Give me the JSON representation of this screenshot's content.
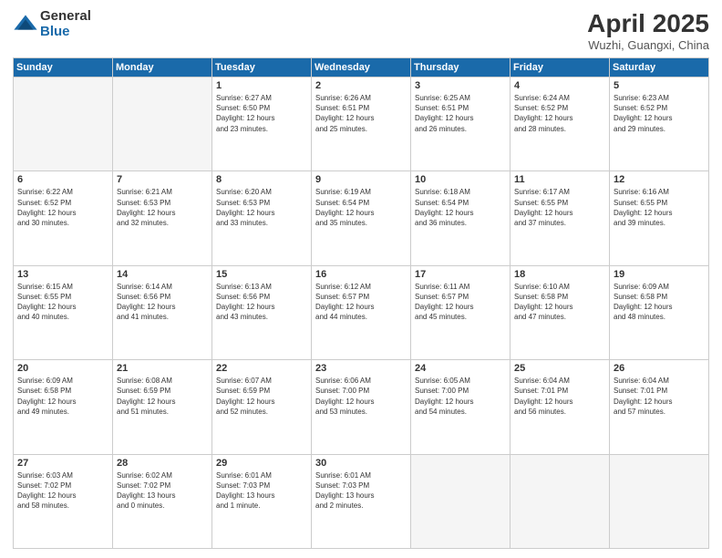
{
  "logo": {
    "general": "General",
    "blue": "Blue"
  },
  "header": {
    "month_year": "April 2025",
    "location": "Wuzhi, Guangxi, China"
  },
  "days_of_week": [
    "Sunday",
    "Monday",
    "Tuesday",
    "Wednesday",
    "Thursday",
    "Friday",
    "Saturday"
  ],
  "weeks": [
    [
      {
        "num": "",
        "info": ""
      },
      {
        "num": "",
        "info": ""
      },
      {
        "num": "1",
        "info": "Sunrise: 6:27 AM\nSunset: 6:50 PM\nDaylight: 12 hours\nand 23 minutes."
      },
      {
        "num": "2",
        "info": "Sunrise: 6:26 AM\nSunset: 6:51 PM\nDaylight: 12 hours\nand 25 minutes."
      },
      {
        "num": "3",
        "info": "Sunrise: 6:25 AM\nSunset: 6:51 PM\nDaylight: 12 hours\nand 26 minutes."
      },
      {
        "num": "4",
        "info": "Sunrise: 6:24 AM\nSunset: 6:52 PM\nDaylight: 12 hours\nand 28 minutes."
      },
      {
        "num": "5",
        "info": "Sunrise: 6:23 AM\nSunset: 6:52 PM\nDaylight: 12 hours\nand 29 minutes."
      }
    ],
    [
      {
        "num": "6",
        "info": "Sunrise: 6:22 AM\nSunset: 6:52 PM\nDaylight: 12 hours\nand 30 minutes."
      },
      {
        "num": "7",
        "info": "Sunrise: 6:21 AM\nSunset: 6:53 PM\nDaylight: 12 hours\nand 32 minutes."
      },
      {
        "num": "8",
        "info": "Sunrise: 6:20 AM\nSunset: 6:53 PM\nDaylight: 12 hours\nand 33 minutes."
      },
      {
        "num": "9",
        "info": "Sunrise: 6:19 AM\nSunset: 6:54 PM\nDaylight: 12 hours\nand 35 minutes."
      },
      {
        "num": "10",
        "info": "Sunrise: 6:18 AM\nSunset: 6:54 PM\nDaylight: 12 hours\nand 36 minutes."
      },
      {
        "num": "11",
        "info": "Sunrise: 6:17 AM\nSunset: 6:55 PM\nDaylight: 12 hours\nand 37 minutes."
      },
      {
        "num": "12",
        "info": "Sunrise: 6:16 AM\nSunset: 6:55 PM\nDaylight: 12 hours\nand 39 minutes."
      }
    ],
    [
      {
        "num": "13",
        "info": "Sunrise: 6:15 AM\nSunset: 6:55 PM\nDaylight: 12 hours\nand 40 minutes."
      },
      {
        "num": "14",
        "info": "Sunrise: 6:14 AM\nSunset: 6:56 PM\nDaylight: 12 hours\nand 41 minutes."
      },
      {
        "num": "15",
        "info": "Sunrise: 6:13 AM\nSunset: 6:56 PM\nDaylight: 12 hours\nand 43 minutes."
      },
      {
        "num": "16",
        "info": "Sunrise: 6:12 AM\nSunset: 6:57 PM\nDaylight: 12 hours\nand 44 minutes."
      },
      {
        "num": "17",
        "info": "Sunrise: 6:11 AM\nSunset: 6:57 PM\nDaylight: 12 hours\nand 45 minutes."
      },
      {
        "num": "18",
        "info": "Sunrise: 6:10 AM\nSunset: 6:58 PM\nDaylight: 12 hours\nand 47 minutes."
      },
      {
        "num": "19",
        "info": "Sunrise: 6:09 AM\nSunset: 6:58 PM\nDaylight: 12 hours\nand 48 minutes."
      }
    ],
    [
      {
        "num": "20",
        "info": "Sunrise: 6:09 AM\nSunset: 6:58 PM\nDaylight: 12 hours\nand 49 minutes."
      },
      {
        "num": "21",
        "info": "Sunrise: 6:08 AM\nSunset: 6:59 PM\nDaylight: 12 hours\nand 51 minutes."
      },
      {
        "num": "22",
        "info": "Sunrise: 6:07 AM\nSunset: 6:59 PM\nDaylight: 12 hours\nand 52 minutes."
      },
      {
        "num": "23",
        "info": "Sunrise: 6:06 AM\nSunset: 7:00 PM\nDaylight: 12 hours\nand 53 minutes."
      },
      {
        "num": "24",
        "info": "Sunrise: 6:05 AM\nSunset: 7:00 PM\nDaylight: 12 hours\nand 54 minutes."
      },
      {
        "num": "25",
        "info": "Sunrise: 6:04 AM\nSunset: 7:01 PM\nDaylight: 12 hours\nand 56 minutes."
      },
      {
        "num": "26",
        "info": "Sunrise: 6:04 AM\nSunset: 7:01 PM\nDaylight: 12 hours\nand 57 minutes."
      }
    ],
    [
      {
        "num": "27",
        "info": "Sunrise: 6:03 AM\nSunset: 7:02 PM\nDaylight: 12 hours\nand 58 minutes."
      },
      {
        "num": "28",
        "info": "Sunrise: 6:02 AM\nSunset: 7:02 PM\nDaylight: 13 hours\nand 0 minutes."
      },
      {
        "num": "29",
        "info": "Sunrise: 6:01 AM\nSunset: 7:03 PM\nDaylight: 13 hours\nand 1 minute."
      },
      {
        "num": "30",
        "info": "Sunrise: 6:01 AM\nSunset: 7:03 PM\nDaylight: 13 hours\nand 2 minutes."
      },
      {
        "num": "",
        "info": ""
      },
      {
        "num": "",
        "info": ""
      },
      {
        "num": "",
        "info": ""
      }
    ]
  ]
}
